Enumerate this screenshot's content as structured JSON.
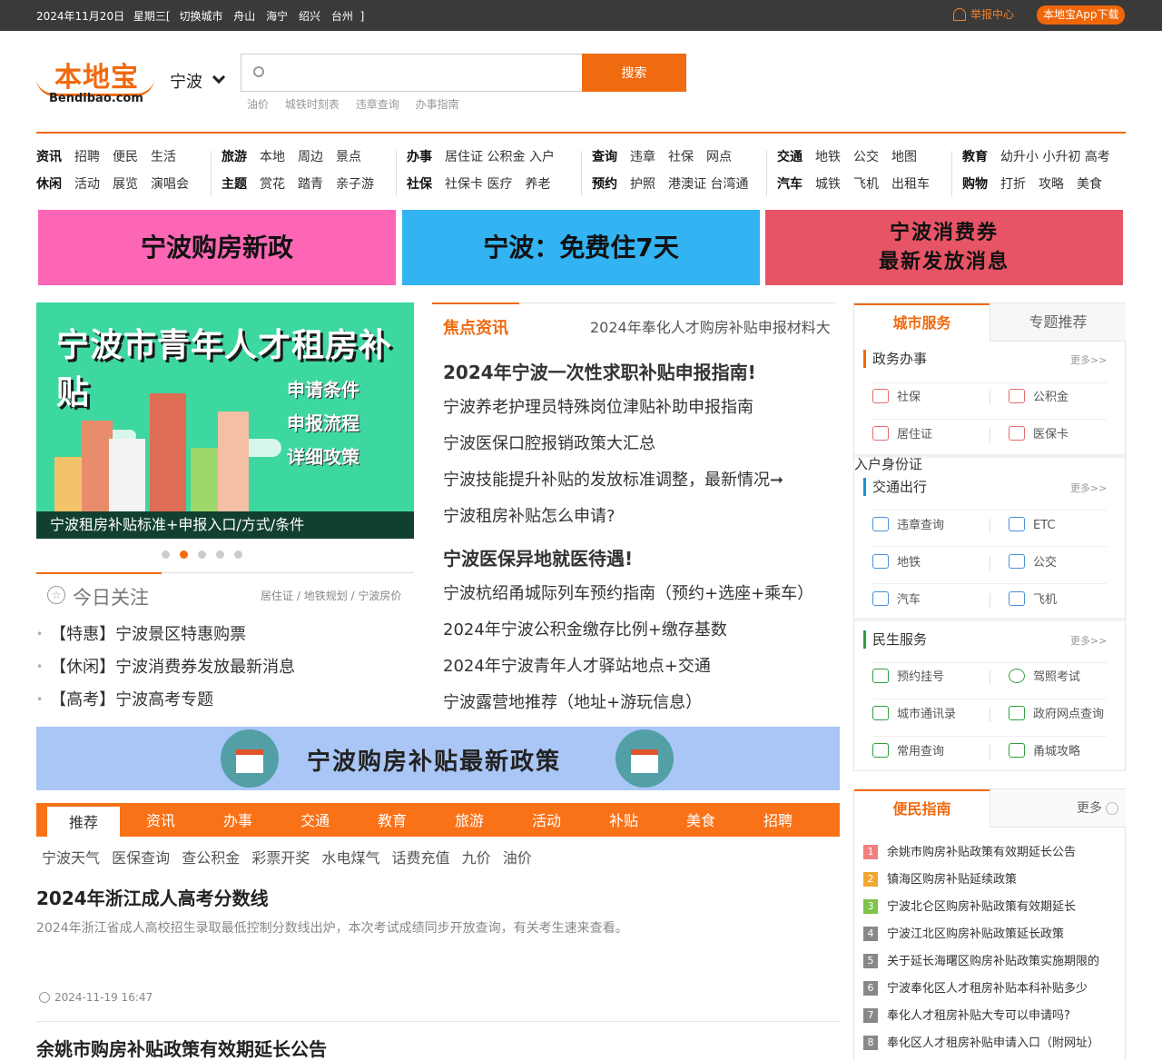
{
  "topbar": {
    "date": "2024年11月20日",
    "weekday": "星期三[",
    "switch_city": "切换城市",
    "cities": [
      "舟山",
      "海宁",
      "绍兴",
      "台州"
    ],
    "bracket": "]",
    "report": "举报中心",
    "app_download": "本地宝App下载"
  },
  "logo": {
    "cn": "本地宝",
    "en": "Bendibao.com"
  },
  "city": "宁波",
  "search": {
    "placeholder": "",
    "button": "搜索",
    "hot": [
      "油价",
      "城铁时刻表",
      "违章查询",
      "办事指南"
    ]
  },
  "nav": [
    {
      "r1": [
        "资讯",
        "招聘",
        "便民",
        "生活"
      ],
      "r2": [
        "休闲",
        "活动",
        "展览",
        "演唱会"
      ]
    },
    {
      "r1": [
        "旅游",
        "本地",
        "周边",
        "景点"
      ],
      "r2": [
        "主题",
        "赏花",
        "踏青",
        "亲子游"
      ]
    },
    {
      "r1": [
        "办事",
        "居住证 公积金 入户"
      ],
      "r2": [
        "社保",
        "社保卡 医疗",
        "养老"
      ]
    },
    {
      "r1": [
        "查询",
        "违章",
        "社保",
        "网点"
      ],
      "r2": [
        "预约",
        "护照",
        "港澳证 台湾通"
      ]
    },
    {
      "r1": [
        "交通",
        "地铁",
        "公交",
        "地图"
      ],
      "r2": [
        "汽车",
        "城铁",
        "飞机",
        "出租车"
      ]
    },
    {
      "r1": [
        "教育",
        "幼升小 小升初 高考"
      ],
      "r2": [
        "购物",
        "打折",
        "攻略",
        "美食"
      ]
    }
  ],
  "banners": {
    "b1": "宁波购房新政",
    "b2": "宁波：免费住7天",
    "b3_l1": "宁波消费券",
    "b3_l2": "最新发放消息"
  },
  "slide": {
    "title": "宁波市青年人才租房补贴",
    "lines": [
      "申请条件",
      "申报流程",
      "详细攻策"
    ],
    "caption": "宁波租房补贴标准+申报入口/方式/条件",
    "active_dot": 2,
    "dot_count": 5
  },
  "attention": {
    "title": "今日关注",
    "tags": [
      "居住证",
      "地铁规划",
      "宁波房价"
    ],
    "items": [
      "【特惠】宁波景区特惠购票",
      "【休闲】宁波消费券发放最新消息",
      "【高考】宁波高考专题"
    ]
  },
  "news": {
    "label": "焦点资讯",
    "marquee": "2024年奉化人才购房补贴申报材料大",
    "headline1": "2024年宁波一次性求职补贴申报指南!",
    "group1": [
      "宁波养老护理员特殊岗位津贴补助申报指南",
      "宁波医保口腔报销政策大汇总",
      "宁波技能提升补贴的发放标准调整，最新情况➞",
      "宁波租房补贴怎么申请?"
    ],
    "headline2": "宁波医保异地就医待遇!",
    "group2": [
      "宁波杭绍甬城际列车预约指南（预约+选座+乘车）",
      "2024年宁波公积金缴存比例+缴存基数",
      "2024年宁波青年人才驿站地点+交通",
      "宁波露营地推荐（地址+游玩信息）"
    ]
  },
  "banner2": "宁波购房补贴最新政策",
  "tabs": [
    "推荐",
    "资讯",
    "办事",
    "交通",
    "教育",
    "旅游",
    "活动",
    "补贴",
    "美食",
    "招聘"
  ],
  "sublinks": [
    "宁波天气",
    "医保查询",
    "查公积金",
    "彩票开奖",
    "水电煤气",
    "话费充值",
    "九价",
    "油价"
  ],
  "article1": {
    "title": "2024年浙江成人高考分数线",
    "desc": "2024年浙江省成人高校招生录取最低控制分数线出炉，本次考试成绩同步开放查询，有关考生速来查看。",
    "time": "2024-11-19 16:47"
  },
  "article2": {
    "title": "余姚市购房补贴政策有效期延长公告"
  },
  "services": {
    "tab1": "城市服务",
    "tab2": "专题推荐",
    "more": "更多>>",
    "sec1": {
      "title": "政务办事",
      "items": [
        "社保",
        "公积金",
        "居住证",
        "医保卡"
      ]
    },
    "stray": "入户身份证",
    "sec2": {
      "title": "交通出行",
      "items": [
        "违章查询",
        "ETC",
        "地铁",
        "公交",
        "汽车",
        "飞机"
      ]
    },
    "sec3": {
      "title": "民生服务",
      "items": [
        "预约挂号",
        "驾照考试",
        "城市通讯录",
        "政府网点查询",
        "常用查询",
        "甬城攻略"
      ]
    }
  },
  "guide": {
    "tab1": "便民指南",
    "tab2": "更多",
    "items": [
      "余姚市购房补贴政策有效期延长公告",
      "镇海区购房补贴延续政策",
      "宁波北仑区购房补贴政策有效期延长",
      "宁波江北区购房补贴政策延长政策",
      "关于延长海曙区购房补贴政策实施期限的",
      "宁波奉化区人才租房补贴本科补贴多少",
      "奉化人才租房补贴大专可以申请吗?",
      "奉化区人才租房补贴申请入口（附网址）"
    ],
    "colors": [
      "#f08080",
      "#f0a830",
      "#7ec24a",
      "#888888",
      "#888888",
      "#888888",
      "#888888",
      "#888888"
    ]
  }
}
